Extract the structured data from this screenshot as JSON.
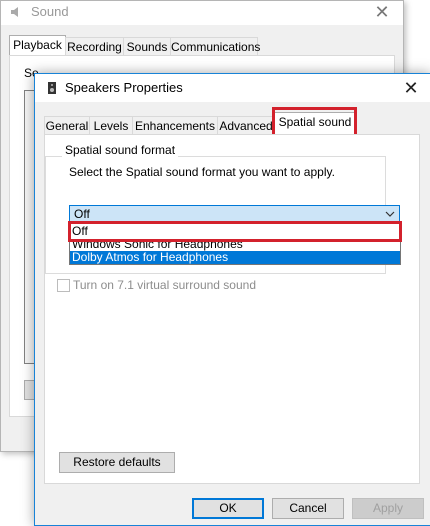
{
  "background_window": {
    "title": "Sound",
    "close": "✕",
    "tabs": [
      "Playback",
      "Recording",
      "Sounds",
      "Communications"
    ],
    "description_partial": "Se"
  },
  "dialog": {
    "title": "Speakers Properties",
    "close": "✕",
    "tabs": [
      "General",
      "Levels",
      "Enhancements",
      "Advanced",
      "Spatial sound"
    ],
    "active_tab": "Spatial sound",
    "group_label": "Spatial sound format",
    "group_description": "Select the Spatial sound format you want to apply.",
    "format_combo": {
      "value": "Off",
      "options": [
        "Off",
        "Windows Sonic for Headphones",
        "Dolby Atmos for Headphones"
      ],
      "highlighted_option": "Dolby Atmos for Headphones"
    },
    "surround_checkbox": {
      "label": "Turn on 7.1 virtual surround sound",
      "checked": false,
      "enabled": false
    },
    "restore_button": "Restore defaults",
    "ok_button": "OK",
    "cancel_button": "Cancel",
    "apply_button": "Apply"
  },
  "colors": {
    "highlight_box": "#d3212c",
    "selection": "#0078d7",
    "accent_border": "#1883d7"
  }
}
